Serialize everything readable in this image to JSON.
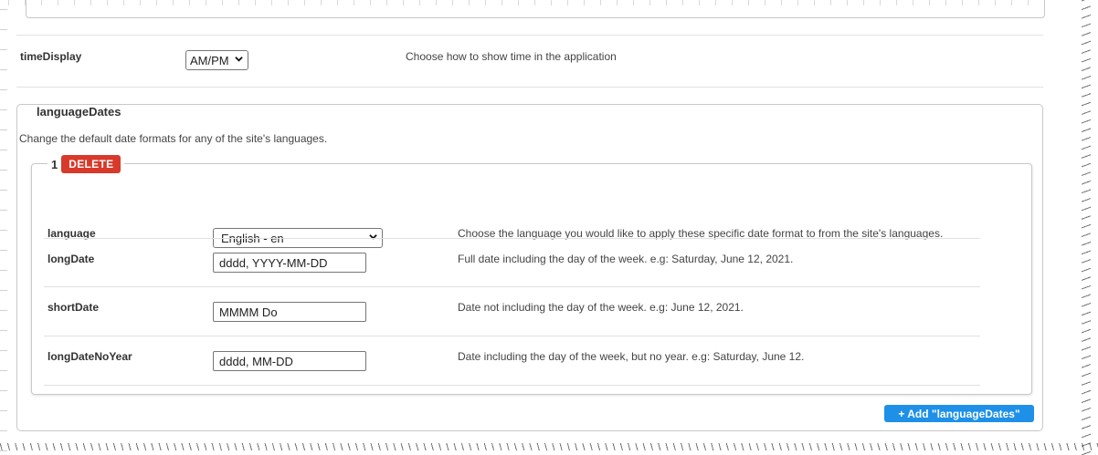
{
  "time_display": {
    "label": "timeDisplay",
    "selected": "AM/PM",
    "help": "Choose how to show time in the application"
  },
  "language_dates": {
    "legend": "languageDates",
    "description": "Change the default date formats for any of the site's languages.",
    "add_button_label": "+ Add \"languageDates\"",
    "items": [
      {
        "index": "1",
        "delete_label": "DELETE",
        "language": {
          "label": "language",
          "selected": "English - en",
          "help": "Choose the language you would like to apply these specific date format to from the site's languages."
        },
        "longDate": {
          "label": "longDate",
          "value": "dddd, YYYY-MM-DD",
          "help": "Full date including the day of the week. e.g: Saturday, June 12, 2021."
        },
        "shortDate": {
          "label": "shortDate",
          "value": "MMMM Do",
          "help": "Date not including the day of the week. e.g: June 12, 2021."
        },
        "longDateNoYear": {
          "label": "longDateNoYear",
          "value": "dddd, MM-DD",
          "help": "Date including the day of the week, but no year. e.g: Saturday, June 12."
        }
      }
    ]
  },
  "colors": {
    "delete_button": "#d9392a",
    "add_button": "#1e90e8",
    "border": "#c8c8c8"
  },
  "icons": {
    "select_arrow": "chevron-down-icon"
  }
}
